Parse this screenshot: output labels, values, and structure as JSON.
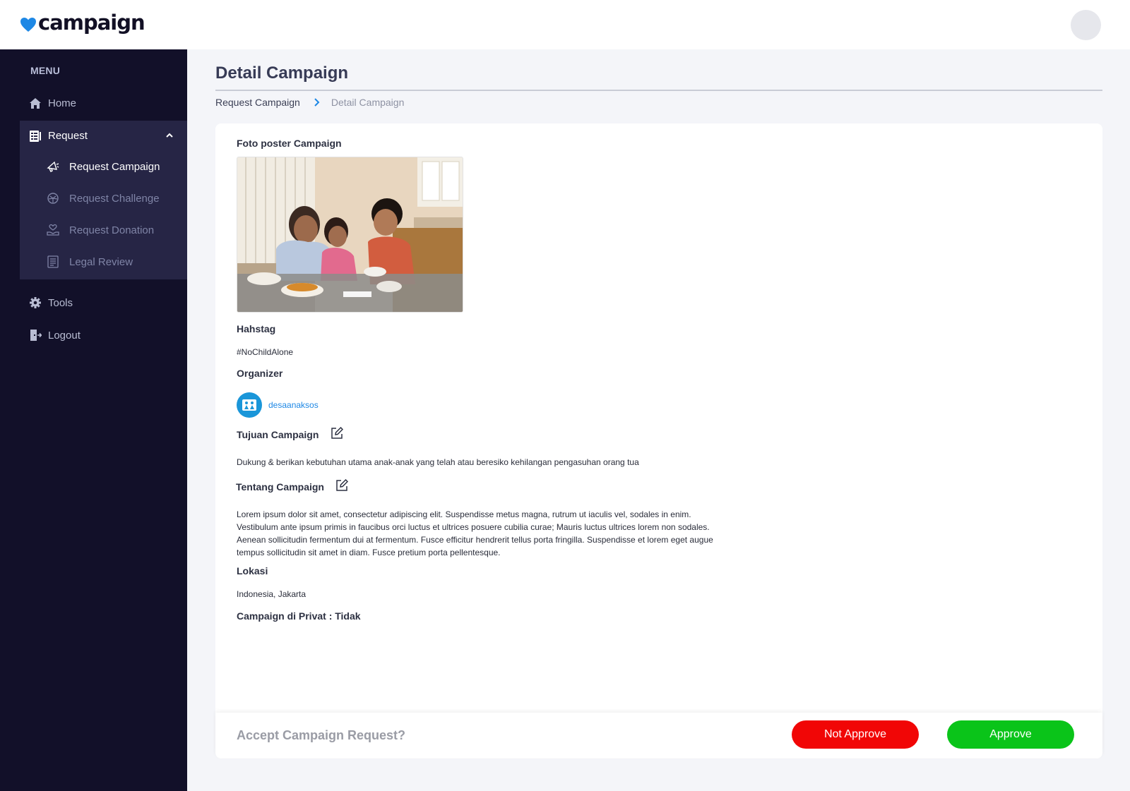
{
  "app": {
    "brand": "campaign"
  },
  "sidebar": {
    "menu_label": "MENU",
    "home": "Home",
    "request": "Request",
    "sub_items": [
      {
        "label": "Request Campaign",
        "icon": "megaphone-icon",
        "active": true
      },
      {
        "label": "Request Challenge",
        "icon": "challenge-icon",
        "active": false
      },
      {
        "label": "Request Donation",
        "icon": "donation-icon",
        "active": false
      },
      {
        "label": "Legal Review",
        "icon": "document-icon",
        "active": false
      }
    ],
    "tools": "Tools",
    "logout": "Logout"
  },
  "main": {
    "title": "Detail Campaign",
    "breadcrumb": {
      "parent": "Request Campaign",
      "current": "Detail Campaign"
    },
    "poster_label": "Foto poster Campaign",
    "hashtag_label": "Hahstag",
    "hashtag_value": "#NoChildAlone",
    "organizer_label": "Organizer",
    "organizer_name": "desaanaksos",
    "goal_label": "Tujuan Campaign",
    "goal_value": "Dukung & berikan kebutuhan utama anak-anak yang telah atau beresiko kehilangan pengasuhan orang tua",
    "about_label": "Tentang Campaign",
    "about_value": "Lorem ipsum dolor sit amet, consectetur adipiscing elit. Suspendisse metus magna, rutrum ut iaculis vel, sodales in enim. Vestibulum ante ipsum primis in faucibus orci luctus et ultrices posuere cubilia curae; Mauris luctus ultrices lorem non sodales. Aenean sollicitudin fermentum dui at fermentum. Fusce efficitur hendrerit tellus porta fringilla. Suspendisse et lorem eget augue tempus sollicitudin sit amet in diam. Fusce pretium porta pellentesque.",
    "location_label": "Lokasi",
    "location_value": "Indonesia, Jakarta",
    "private_label": "Campaign di Privat : Tidak"
  },
  "actions": {
    "question": "Accept Campaign Request?",
    "reject": "Not Approve",
    "approve": "Approve"
  },
  "colors": {
    "sidebar_bg": "#121029",
    "submenu_bg": "#262545",
    "brand_blue": "#1e88e5",
    "reject_red": "#f10606",
    "approve_green": "#0ac419"
  }
}
